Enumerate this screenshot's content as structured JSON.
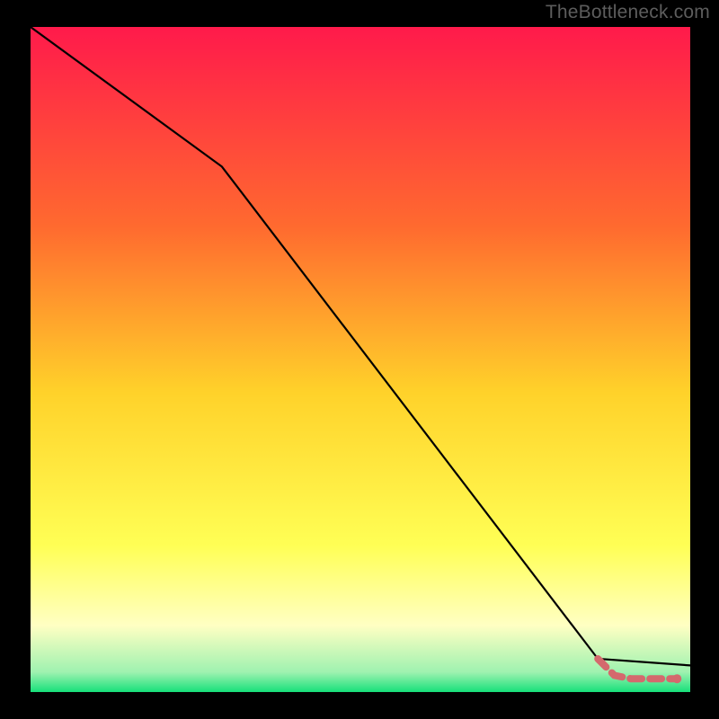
{
  "watermark": "TheBottleneck.com",
  "colors": {
    "background": "#000000",
    "gradient_top": "#ff1a4b",
    "gradient_mid1": "#ff8a2a",
    "gradient_mid2": "#ffe92a",
    "gradient_low": "#ffffb0",
    "gradient_bottom": "#16e07a",
    "line": "#000000",
    "dash": "#d4696d",
    "watermark": "#5d5d5d"
  },
  "chart_data": {
    "type": "line",
    "title": "",
    "xlabel": "",
    "ylabel": "",
    "xlim": [
      0,
      100
    ],
    "ylim": [
      0,
      100
    ],
    "x": [
      0,
      29,
      86,
      88.5,
      91,
      93,
      95,
      96.5,
      98,
      100
    ],
    "y": [
      100,
      79,
      5,
      2.5,
      2,
      2,
      2,
      2,
      2,
      4
    ],
    "series": [
      {
        "name": "bottleneck-curve",
        "style": "solid",
        "color": "#000000",
        "x": [
          0,
          29,
          86,
          100
        ],
        "y": [
          100,
          79,
          5,
          4
        ]
      },
      {
        "name": "optimal-range-dash",
        "style": "dashed",
        "color": "#d4696d",
        "x": [
          86,
          88.5,
          91,
          93,
          95,
          96.5,
          98
        ],
        "y": [
          5,
          2.5,
          2,
          2,
          2,
          2,
          2
        ]
      }
    ],
    "annotations": [
      {
        "type": "dot",
        "x": 98,
        "y": 2,
        "color": "#d4696d"
      }
    ],
    "background_gradient_stops": [
      {
        "offset": 0.0,
        "color": "#ff1a4b"
      },
      {
        "offset": 0.3,
        "color": "#ff6a2f"
      },
      {
        "offset": 0.55,
        "color": "#ffd22a"
      },
      {
        "offset": 0.78,
        "color": "#ffff55"
      },
      {
        "offset": 0.9,
        "color": "#ffffc3"
      },
      {
        "offset": 0.97,
        "color": "#9ff2b0"
      },
      {
        "offset": 1.0,
        "color": "#16e07a"
      }
    ]
  }
}
